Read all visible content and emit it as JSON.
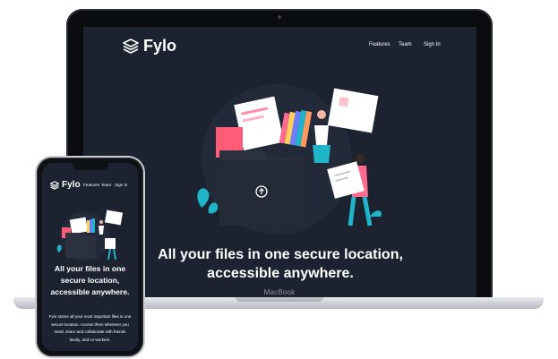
{
  "laptop": {
    "model_label": "MacBook",
    "brand": "Fylo",
    "nav": [
      "Features",
      "Team",
      "Sign In"
    ],
    "heading": "All your files in one secure location, accessible anywhere.",
    "logo_icon": "stacked-layers-icon",
    "upload_icon": "upload-arrow-icon"
  },
  "phone": {
    "brand": "Fylo",
    "nav": [
      "Features",
      "Team",
      "Sign In"
    ],
    "heading": "All your files in one secure location, accessible anywhere.",
    "body": "Fylo stores all your most important files in one secure location. Access them wherever you need, share and collaborate with friends family, and co-workers."
  },
  "colors": {
    "background": "#1c2230",
    "text": "#ffffff",
    "folder": "#2c3140",
    "accent_teal": "#1fb4c8",
    "accent_pink": "#ff6a8e"
  }
}
